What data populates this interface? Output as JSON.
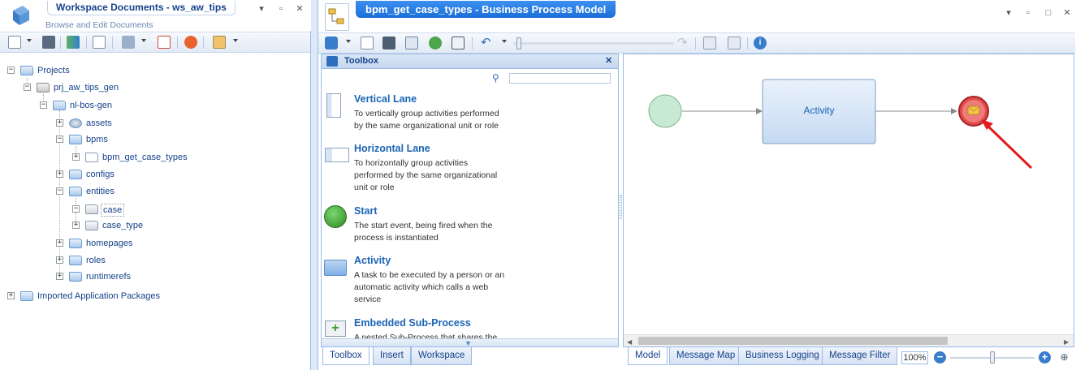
{
  "workspace": {
    "title": "Workspace Documents - ws_aw_tips",
    "subtitle": "Browse and Edit Documents"
  },
  "tree": {
    "projects": "Projects",
    "project": "prj_aw_tips_gen",
    "package": "nl-bos-gen",
    "assets": "assets",
    "bpms": "bpms",
    "bpm_model": "bpm_get_case_types",
    "configs": "configs",
    "entities": "entities",
    "case": "case",
    "case_type": "case_type",
    "homepages": "homepages",
    "roles": "roles",
    "runtimerefs": "runtimerefs",
    "imported": "Imported Application Packages"
  },
  "editor": {
    "title": "bpm_get_case_types - Business Process Model"
  },
  "toolbox": {
    "header": "Toolbox",
    "items": [
      {
        "title": "Vertical Lane",
        "desc": "To vertically group activities performed by the same organizational unit or role"
      },
      {
        "title": "Horizontal Lane",
        "desc": "To horizontally group activities performed by the same organizational unit or role"
      },
      {
        "title": "Start",
        "desc": "The start event, being fired when the process is instantiated"
      },
      {
        "title": "Activity",
        "desc": "A task to be executed by a person or an automatic activity which calls a web service"
      },
      {
        "title": "Embedded Sub-Process",
        "desc": "A nested Sub-Process that shares the"
      }
    ]
  },
  "canvas": {
    "activity_label": "Activity"
  },
  "left_tabs": [
    "Toolbox",
    "Insert",
    "Workspace"
  ],
  "right_tabs": [
    "Model",
    "Message Map",
    "Business Logging",
    "Message Filter"
  ],
  "zoom": "100%",
  "colors": {
    "accent": "#1a6fd8",
    "panel_border": "#99bbe8",
    "start_event": "#c8ead2",
    "end_event": "#e04a4a",
    "activity_fill": "#d6e4f6"
  }
}
